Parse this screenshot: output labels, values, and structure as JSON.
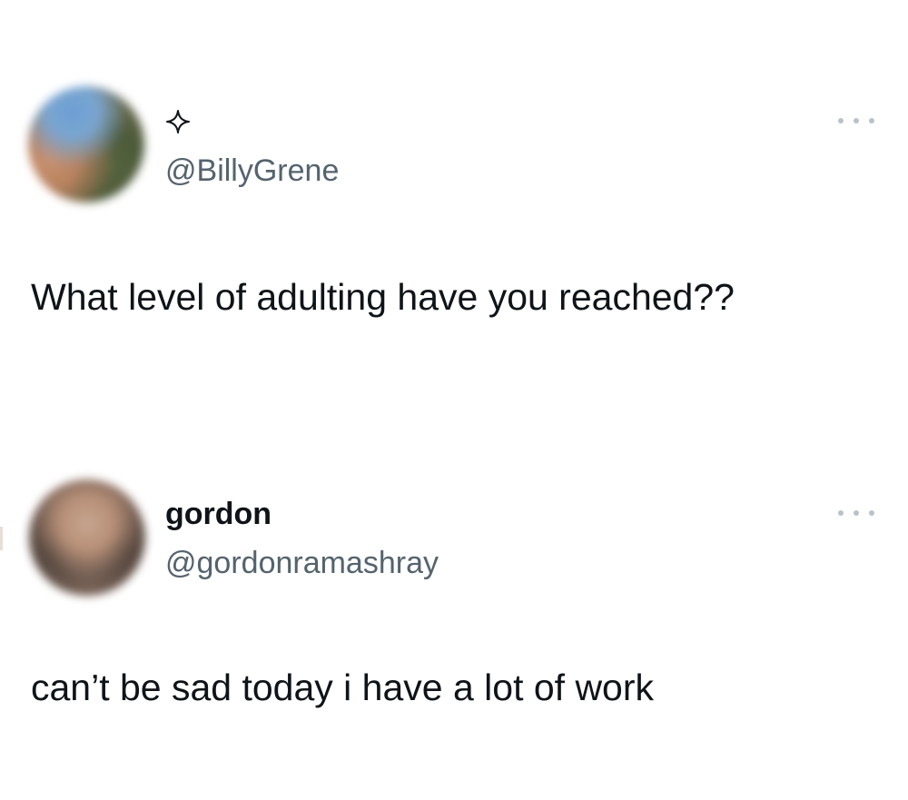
{
  "posts": [
    {
      "display_name": "",
      "handle": "@BillyGrene",
      "text": "What level of adulting have you reached??",
      "badge_icon": "sparkle-icon",
      "menu_icon": "more-horizontal-icon"
    },
    {
      "display_name": "gordon",
      "handle": "@gordonramashray",
      "text": "can’t be sad today i have a lot of work",
      "menu_icon": "more-horizontal-icon"
    }
  ],
  "colors": {
    "background": "#ffffff",
    "primary_text": "#0f1419",
    "secondary_text": "#536471",
    "menu_dots": "#b9c2ca"
  }
}
